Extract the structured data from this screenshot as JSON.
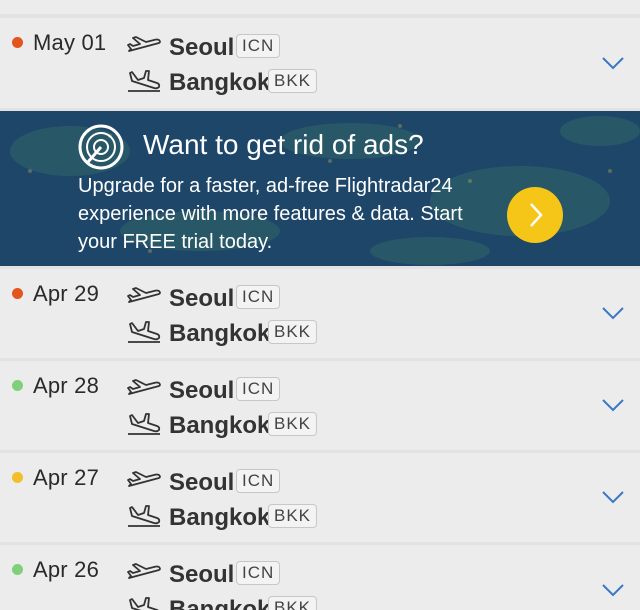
{
  "flights": [
    {
      "date": "May 01",
      "status_color": "#e2561e",
      "origin": {
        "city": "Seoul",
        "code": "ICN"
      },
      "destination": {
        "city": "Bangkok",
        "code": "BKK"
      }
    },
    {
      "date": "Apr 29",
      "status_color": "#e2561e",
      "origin": {
        "city": "Seoul",
        "code": "ICN"
      },
      "destination": {
        "city": "Bangkok",
        "code": "BKK"
      }
    },
    {
      "date": "Apr 28",
      "status_color": "#7fd07a",
      "origin": {
        "city": "Seoul",
        "code": "ICN"
      },
      "destination": {
        "city": "Bangkok",
        "code": "BKK"
      }
    },
    {
      "date": "Apr 27",
      "status_color": "#f3be2a",
      "origin": {
        "city": "Seoul",
        "code": "ICN"
      },
      "destination": {
        "city": "Bangkok",
        "code": "BKK"
      }
    },
    {
      "date": "Apr 26",
      "status_color": "#7fd07a",
      "origin": {
        "city": "Seoul",
        "code": "ICN"
      },
      "destination": {
        "city": "Bangkok",
        "code": "BKK"
      }
    }
  ],
  "ad": {
    "title": "Want to get rid of ads?",
    "line1": "Upgrade for a faster, ad-free Flightradar24",
    "line2": "experience with more features & data. Start",
    "line3": "your FREE trial today.",
    "accent": "#f5c518",
    "background": "#1d4669"
  },
  "icons": {
    "takeoff": "takeoff-plane-icon",
    "landing": "landing-plane-icon",
    "expand": "chevron-down-icon",
    "radar": "radar-logo-icon",
    "cta": "chevron-right-icon"
  }
}
